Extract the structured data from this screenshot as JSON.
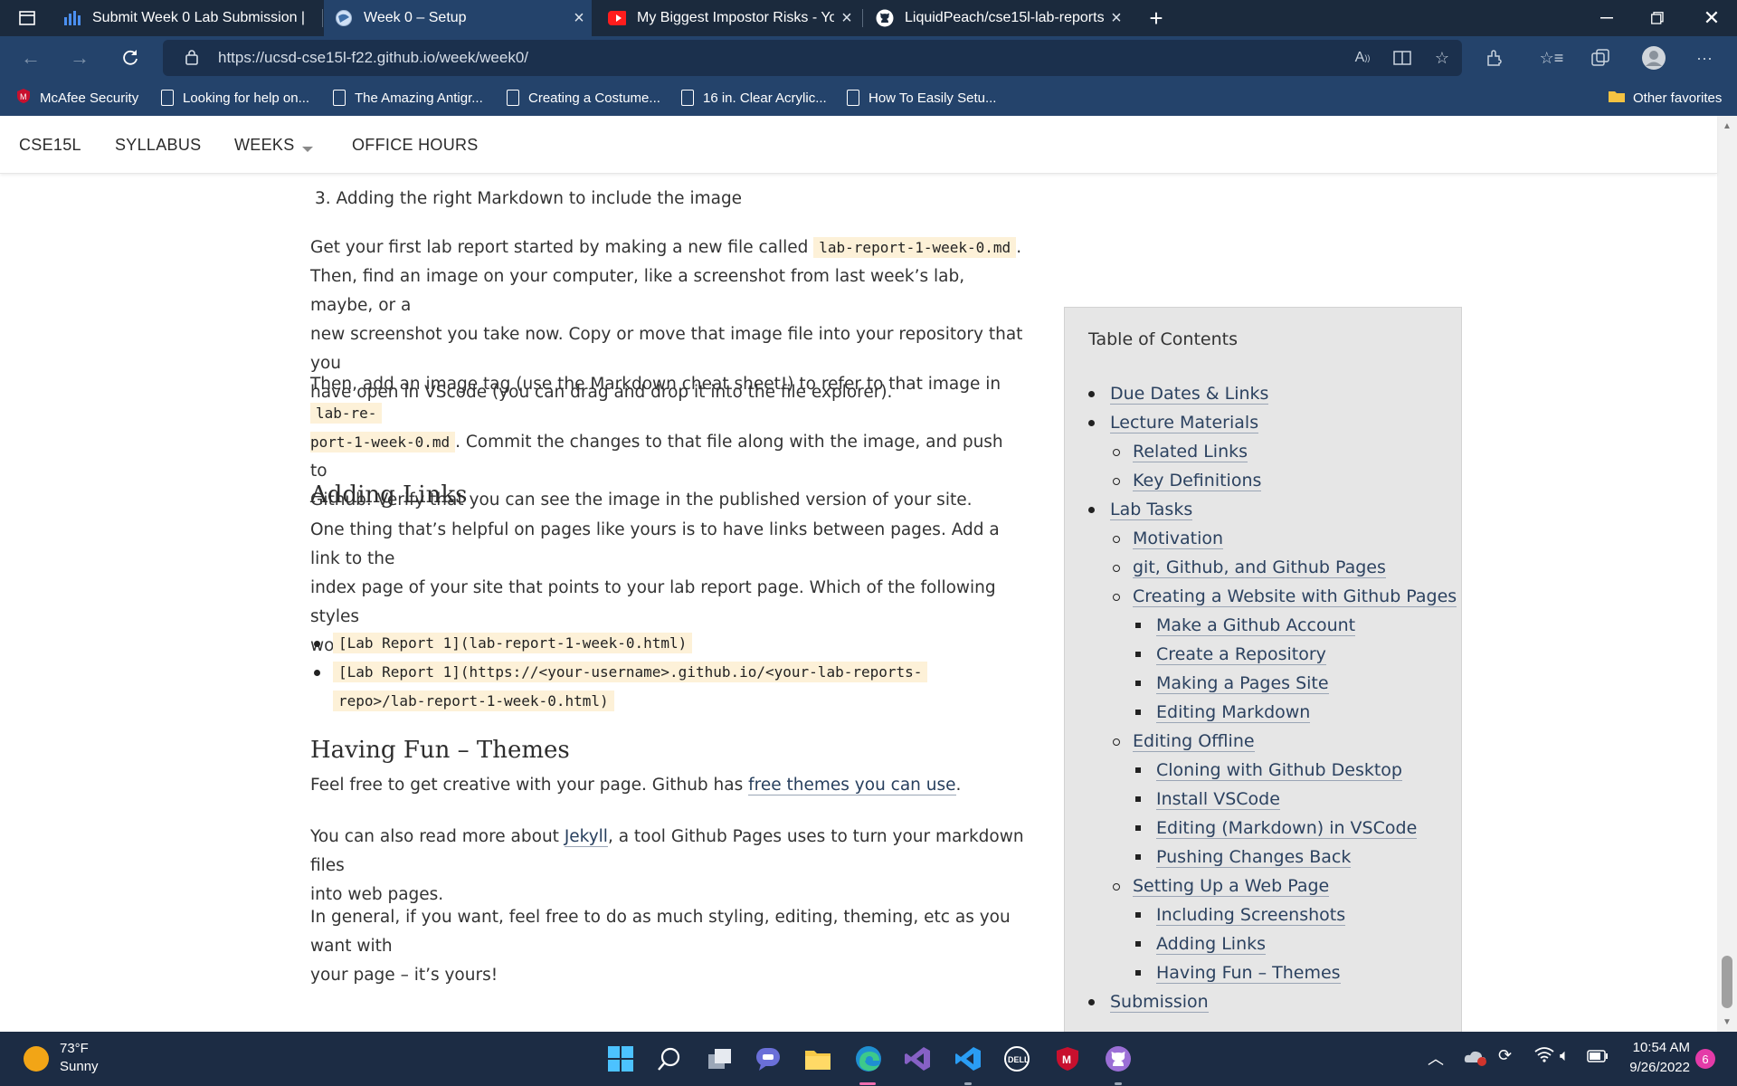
{
  "browser": {
    "tabs": [
      {
        "title": "Submit Week 0 Lab Submission |",
        "active": false
      },
      {
        "title": "Week 0 – Setup",
        "active": true
      },
      {
        "title": "My Biggest Impostor Risks - You",
        "active": false
      },
      {
        "title": "LiquidPeach/cse15l-lab-reports",
        "active": false
      }
    ],
    "url": "https://ucsd-cse15l-f22.github.io/week/week0/",
    "favorites": [
      "McAfee Security",
      "Looking for help on...",
      "The Amazing Antigr...",
      "Creating a Costume...",
      "16 in. Clear Acrylic...",
      "How To Easily Setu..."
    ],
    "other_favorites": "Other favorites"
  },
  "site_nav": {
    "items": [
      "CSE15L",
      "SYLLABUS",
      "WEEKS",
      "OFFICE HOURS"
    ]
  },
  "content": {
    "list_item_3": "3. Adding the right Markdown to include the image",
    "p1": {
      "a": "Get your first lab report started by making a new file called",
      "code": "lab-report-1-week-0.md",
      "b": ".",
      "l2": "Then, find an image on your computer, like a screenshot from last week’s lab, maybe, or a",
      "l3": "new screenshot you take now. Copy or move that image file into your repository that you",
      "l4": "have open in VScode (you can drag and drop it into the file explorer)."
    },
    "p2": {
      "a": "Then, add an image tag (use the Markdown cheat sheet!) to refer to that image in",
      "code_a": "lab-re-",
      "code_b": "port-1-week-0.md",
      "b": ". Commit the changes to that file along with the image, and push to",
      "l3": "Github. Verify that you can see the image in the published version of your site."
    },
    "adding_links": {
      "heading": "Adding Links",
      "l1": "One thing that’s helpful on pages like yours is to have links between pages. Add a link to the",
      "l2": "index page of your site that points to your lab report page. Which of the following styles",
      "l3": "works?",
      "code1": "[Lab Report 1](lab-report-1-week-0.html)",
      "code2a": "[Lab Report 1](https://<your-username>.github.io/<your-lab-reports-",
      "code2b": "repo>/lab-report-1-week-0.html)"
    },
    "themes": {
      "heading": "Having Fun – Themes",
      "l1a": "Feel free to get creative with your page. Github has",
      "l1_link": "free themes you can use",
      "l1b": ".",
      "p2a": "You can also read more about",
      "p2_link": "Jekyll",
      "p2b": ", a tool Github Pages uses to turn your markdown files",
      "p2l2": "into web pages.",
      "p3l1": "In general, if you want, feel free to do as much styling, editing, theming, etc as you want with",
      "p3l2": "your page – it’s yours!"
    }
  },
  "toc": {
    "title": "Table of Contents",
    "items": [
      {
        "label": "Due Dates & Links",
        "level": 1
      },
      {
        "label": "Lecture Materials",
        "level": 1
      },
      {
        "label": "Related Links",
        "level": 2
      },
      {
        "label": "Key Definitions",
        "level": 2
      },
      {
        "label": "Lab Tasks",
        "level": 1
      },
      {
        "label": "Motivation",
        "level": 2
      },
      {
        "label": "git, Github, and Github Pages",
        "level": 2
      },
      {
        "label": "Creating a Website with Github Pages",
        "level": 2
      },
      {
        "label": "Make a Github Account",
        "level": 3
      },
      {
        "label": "Create a Repository",
        "level": 3
      },
      {
        "label": "Making a Pages Site",
        "level": 3
      },
      {
        "label": "Editing Markdown",
        "level": 3
      },
      {
        "label": "Editing Offline",
        "level": 2
      },
      {
        "label": "Cloning with Github Desktop",
        "level": 3
      },
      {
        "label": "Install VSCode",
        "level": 3
      },
      {
        "label": "Editing (Markdown) in VSCode",
        "level": 3
      },
      {
        "label": "Pushing Changes Back",
        "level": 3
      },
      {
        "label": "Setting Up a Web Page",
        "level": 2
      },
      {
        "label": "Including Screenshots",
        "level": 3
      },
      {
        "label": "Adding Links",
        "level": 3
      },
      {
        "label": "Having Fun – Themes",
        "level": 3
      },
      {
        "label": "Submission",
        "level": 1
      }
    ]
  },
  "taskbar": {
    "weather_temp": "73°F",
    "weather_cond": "Sunny",
    "time": "10:54 AM",
    "date": "9/26/2022",
    "notification_count": "6"
  },
  "colors": {
    "tab_strip": "#1b2a3d",
    "toolbar": "#24436b",
    "taskbar": "#1c2c44",
    "code_bg": "#fdf1d8",
    "toc_bg": "#e6e6e6"
  }
}
